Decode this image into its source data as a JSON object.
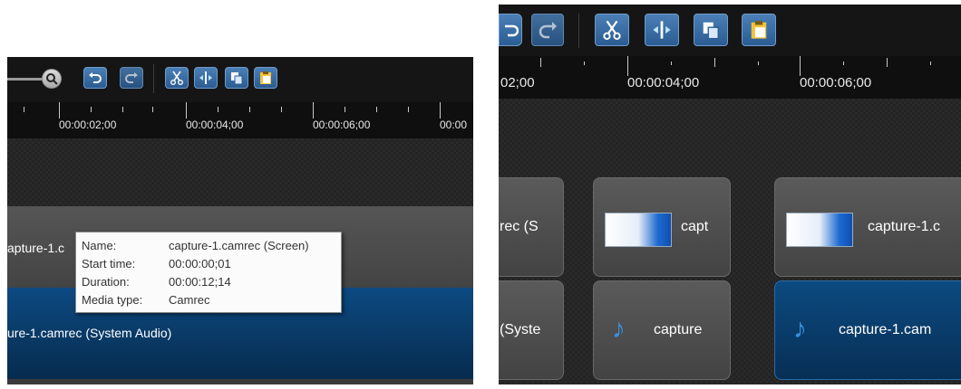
{
  "left": {
    "ruler_labels": [
      "00:00:02;00",
      "00:00:04;00",
      "00:00:06;00",
      "00:00"
    ],
    "screen_clip_label": "apture-1.c",
    "audio_clip_label": "ure-1.camrec (System Audio)",
    "tooltip": {
      "rows": [
        {
          "key": "Name:",
          "value": "capture-1.camrec (Screen)"
        },
        {
          "key": "Start time:",
          "value": "00:00:00;01"
        },
        {
          "key": "Duration:",
          "value": "00:00:12;14"
        },
        {
          "key": "Media type:",
          "value": "Camrec"
        }
      ]
    }
  },
  "right": {
    "ruler_labels": [
      "02;00",
      "00:00:04;00",
      "00:00:06;00"
    ],
    "screen_clips": [
      "rec (S",
      "capt",
      "capture-1.c"
    ],
    "audio_clips": [
      "(Syste",
      "capture",
      "capture-1.cam"
    ]
  },
  "icons": [
    "zoom-icon",
    "undo-icon",
    "redo-icon",
    "cut-icon",
    "split-icon",
    "copy-icon",
    "paste-icon",
    "music-note-icon"
  ]
}
